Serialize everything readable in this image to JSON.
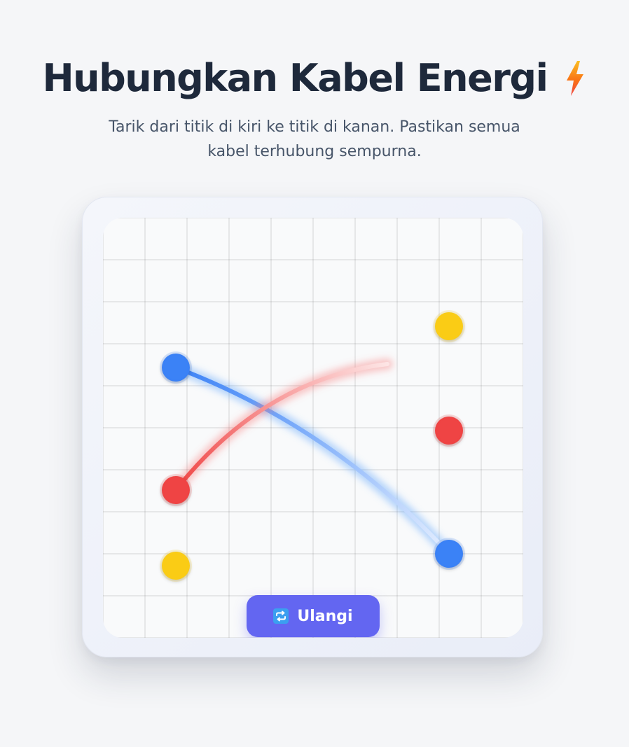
{
  "header": {
    "title": "Hubungkan Kabel Energi",
    "title_icon": "lightning-bolt-icon",
    "subtitle_line1": "Tarik dari titik di kiri ke titik di kanan. Pastikan semua",
    "subtitle_line2": "kabel terhubung sempurna."
  },
  "board": {
    "grid_divisions": 10,
    "left_nodes": [
      {
        "color_name": "blue",
        "color": "#3b82f6"
      },
      {
        "color_name": "red",
        "color": "#ef4444"
      },
      {
        "color_name": "yellow",
        "color": "#facc15"
      }
    ],
    "right_nodes": [
      {
        "color_name": "yellow",
        "color": "#facc15"
      },
      {
        "color_name": "red",
        "color": "#ef4444"
      },
      {
        "color_name": "blue",
        "color": "#3b82f6"
      }
    ],
    "wires": [
      {
        "color_name": "blue",
        "from": "left-blue",
        "to": "right-blue",
        "state": "connected"
      },
      {
        "color_name": "red",
        "from": "left-red",
        "to": null,
        "state": "dragging"
      }
    ]
  },
  "controls": {
    "restart_label": "Ulangi",
    "restart_icon": "repeat-icon"
  },
  "colors": {
    "accent": "#6366f1",
    "title": "#1e293b",
    "subtitle": "#475569"
  }
}
